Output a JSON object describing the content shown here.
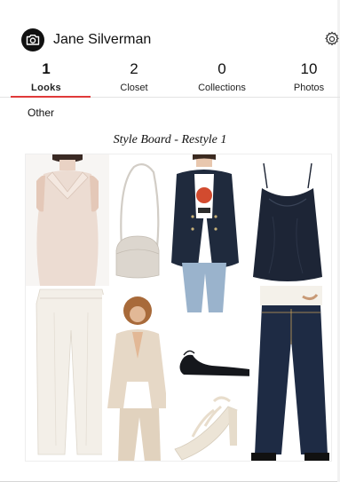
{
  "header": {
    "username": "Jane Silverman",
    "avatar_icon": "camera-icon",
    "settings_icon": "gear-icon"
  },
  "tabs": [
    {
      "count": "1",
      "label": "Looks",
      "active": true
    },
    {
      "count": "2",
      "label": "Closet",
      "active": false
    },
    {
      "count": "0",
      "label": "Collections",
      "active": false
    },
    {
      "count": "10",
      "label": "Photos",
      "active": false
    }
  ],
  "section": {
    "title": "Other"
  },
  "board": {
    "title": "Style Board - Restyle 1",
    "items": [
      {
        "name": "blush-sleeveless-blouse"
      },
      {
        "name": "cream-crossbody-bag"
      },
      {
        "name": "navy-blazer-jeans-outfit"
      },
      {
        "name": "navy-satin-camisole"
      },
      {
        "name": "white-trousers"
      },
      {
        "name": "cream-suit-model"
      },
      {
        "name": "black-slingback-flat"
      },
      {
        "name": "dark-flare-jeans-outfit"
      },
      {
        "name": "white-strappy-sandal"
      }
    ]
  },
  "colors": {
    "accent": "#e03a3a",
    "text": "#111111"
  }
}
